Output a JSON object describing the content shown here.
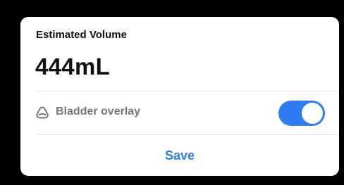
{
  "card": {
    "label": "Estimated Volume",
    "value": "444mL"
  },
  "overlay": {
    "icon": "bladder-icon",
    "label": "Bladder overlay",
    "enabled": true
  },
  "actions": {
    "save_label": "Save"
  },
  "colors": {
    "background": "#000000",
    "card": "#ffffff",
    "accent": "#2f7bf2",
    "secondary_text": "#777778"
  }
}
